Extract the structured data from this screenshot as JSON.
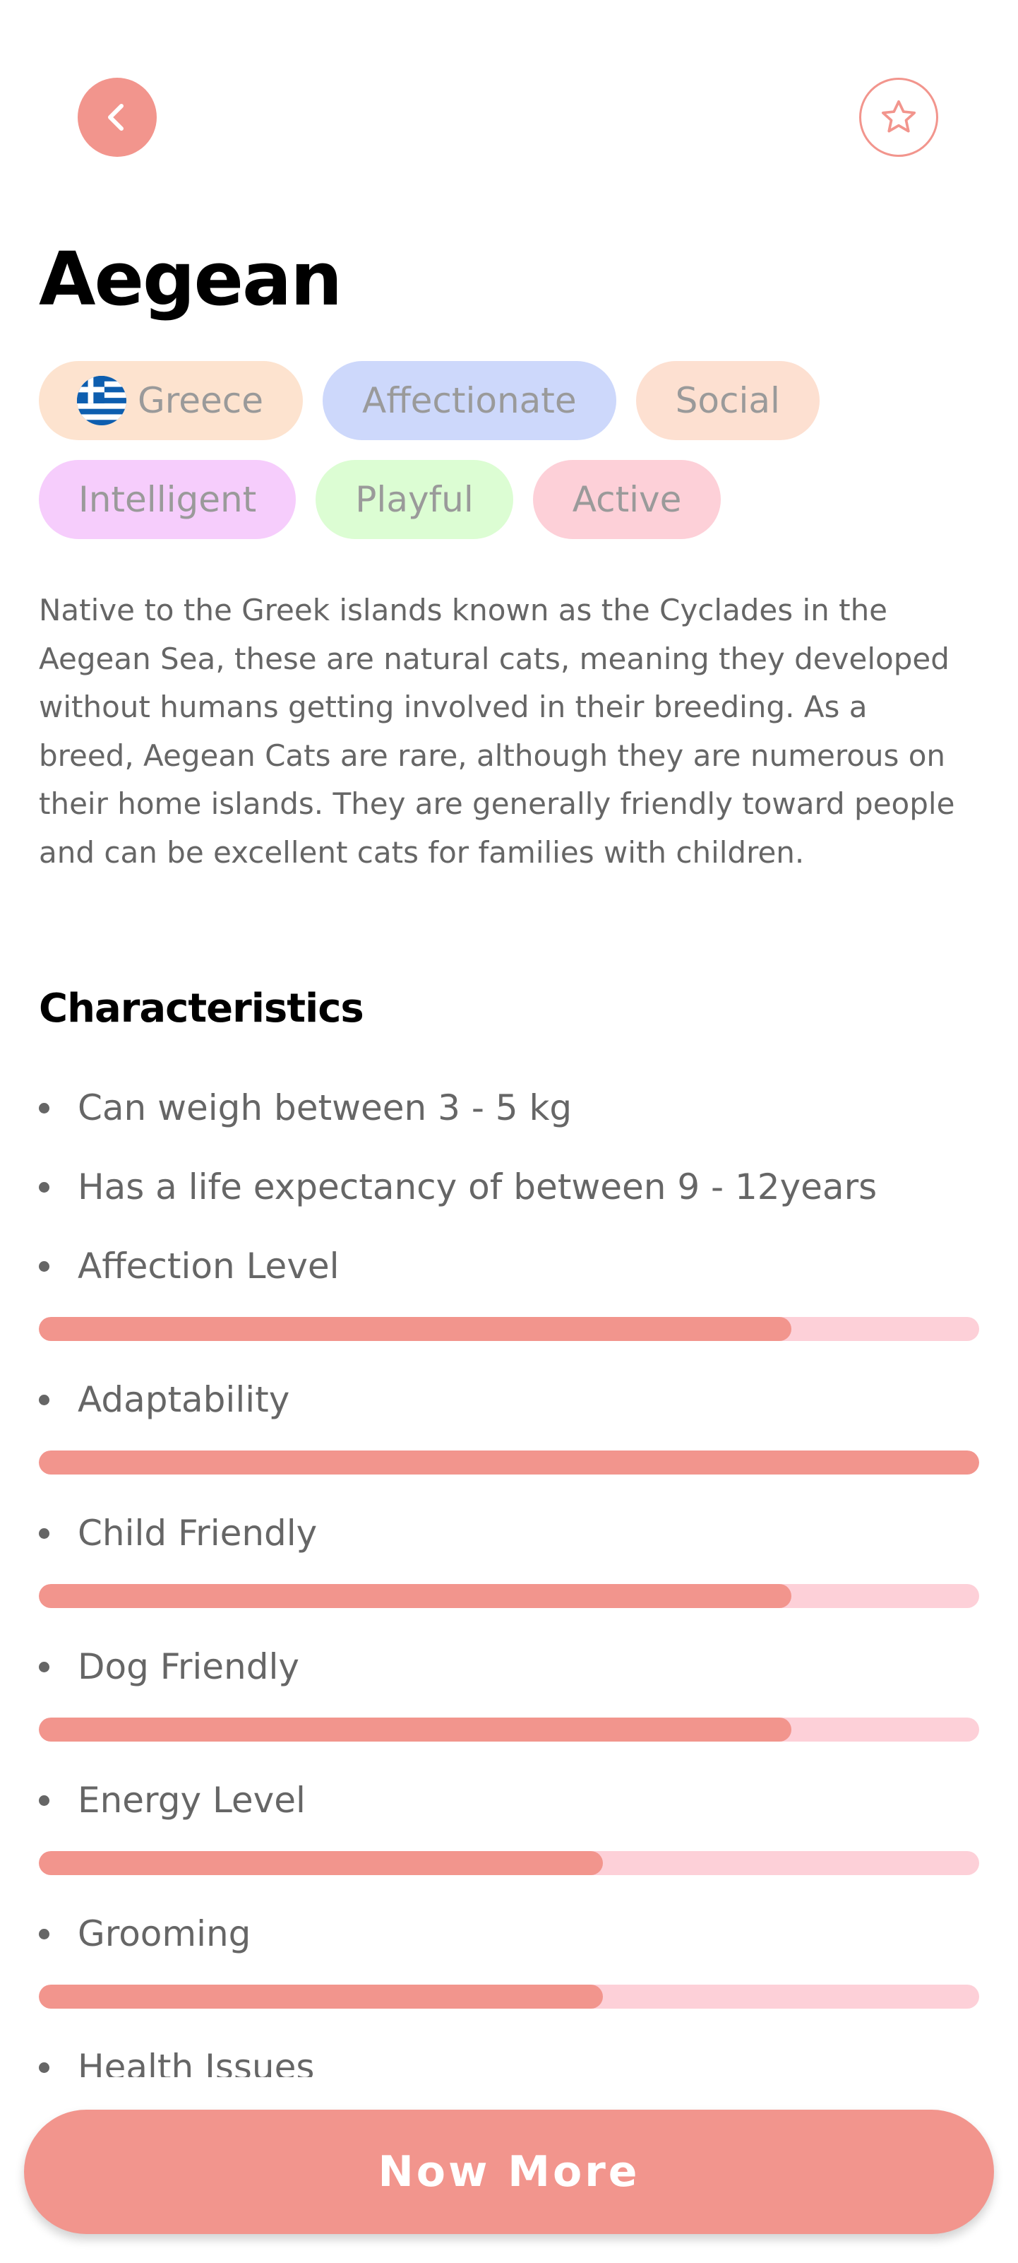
{
  "header": {
    "back_icon": "chevron-left-icon",
    "favorite_icon": "star-outline-icon"
  },
  "breed": {
    "name": "Aegean",
    "origin": "Greece",
    "temperament": [
      "Affectionate",
      "Social",
      "Intelligent",
      "Playful",
      "Active"
    ],
    "description": "Native to the Greek islands known as the Cyclades in the Aegean Sea, these are natural cats, meaning they developed without humans getting involved in their breeding. As a breed, Aegean Cats are rare, although they are numerous on their home islands. They are generally friendly toward people and can be excellent cats for families with children."
  },
  "characteristics": {
    "title": "Characteristics",
    "weight": "Can weigh between 3 - 5 kg",
    "life_span": "Has a life expectancy of between 9 - 12years",
    "ratings": [
      {
        "label": "Affection Level",
        "value": 4,
        "max": 5
      },
      {
        "label": "Adaptability",
        "value": 5,
        "max": 5
      },
      {
        "label": "Child Friendly",
        "value": 4,
        "max": 5
      },
      {
        "label": "Dog Friendly",
        "value": 4,
        "max": 5
      },
      {
        "label": "Energy Level",
        "value": 3,
        "max": 5
      },
      {
        "label": "Grooming",
        "value": 3,
        "max": 5
      },
      {
        "label": "Health Issues"
      }
    ]
  },
  "cta": {
    "label": "Now More"
  },
  "colors": {
    "accent": "#f2958d",
    "bar_track": "#fdd0d8",
    "tag_backgrounds": [
      "#fde3cf",
      "#cdd8fb",
      "#fde0d1",
      "#f6cdfc",
      "#dcfdd3",
      "#fdd0d8"
    ]
  }
}
